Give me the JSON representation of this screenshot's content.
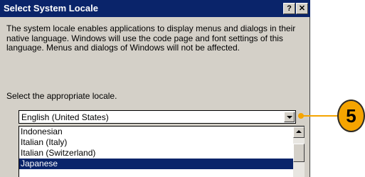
{
  "dialog": {
    "title": "Select System Locale",
    "help_label": "?",
    "close_label": "✕",
    "description": "The system locale enables applications to display menus and dialogs in their native language.  Windows will use the code page and font settings of this language.  Menus and dialogs of Windows will not be affected.",
    "prompt": "Select the appropriate locale.",
    "combo": {
      "value": "English (United States)"
    },
    "list": {
      "items": [
        {
          "label": "Indonesian"
        },
        {
          "label": "Italian (Italy)"
        },
        {
          "label": "Italian (Switzerland)"
        },
        {
          "label": "Japanese",
          "selected": true
        }
      ]
    }
  },
  "callout": {
    "number": "5",
    "color": "#f5a400"
  },
  "colors": {
    "titlebar": "#0a246a",
    "dialog_bg": "#d4d0c8",
    "selection": "#0a246a"
  }
}
